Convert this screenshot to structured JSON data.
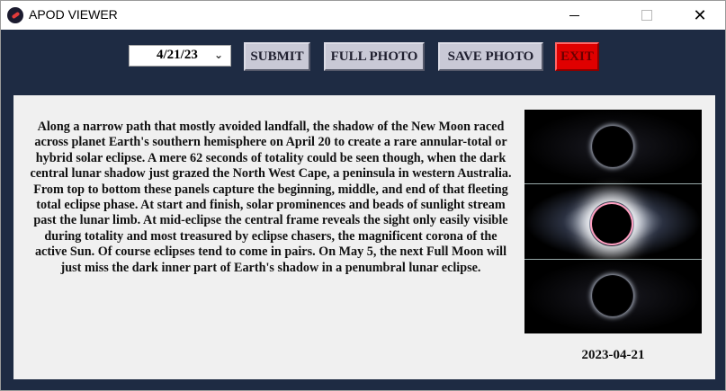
{
  "window": {
    "title": "APOD VIEWER"
  },
  "toolbar": {
    "date_value": "4/21/23",
    "submit_label": "SUBMIT",
    "full_photo_label": "FULL PHOTO",
    "save_photo_label": "SAVE PHOTO",
    "exit_label": "EXIT"
  },
  "content": {
    "description": "Along a narrow path that mostly avoided landfall, the shadow of the New Moon raced across planet Earth's southern hemisphere on April 20 to create a rare annular-total or hybrid solar eclipse. A mere 62 seconds of totality could be seen though, when the dark central lunar shadow just grazed the North West Cape, a peninsula in western Australia. From top to bottom these panels capture the beginning, middle, and end of that fleeting total eclipse phase. At start and finish, solar prominences and beads of sunlight stream past the lunar limb. At mid-eclipse the central frame reveals the sight only easily visible during totality and most treasured by eclipse chasers, the magnificent corona of the active Sun. Of course eclipses tend to come in pairs. On May 5, the next Full Moon will just miss the dark inner part of Earth's shadow in a penumbral lunar eclipse.",
    "photo_date": "2023-04-21"
  },
  "colors": {
    "window_bg": "#1e2b43",
    "panel_bg": "#f0f0f0",
    "button_bg": "#c9c9d6",
    "exit_bg": "#e00000"
  }
}
